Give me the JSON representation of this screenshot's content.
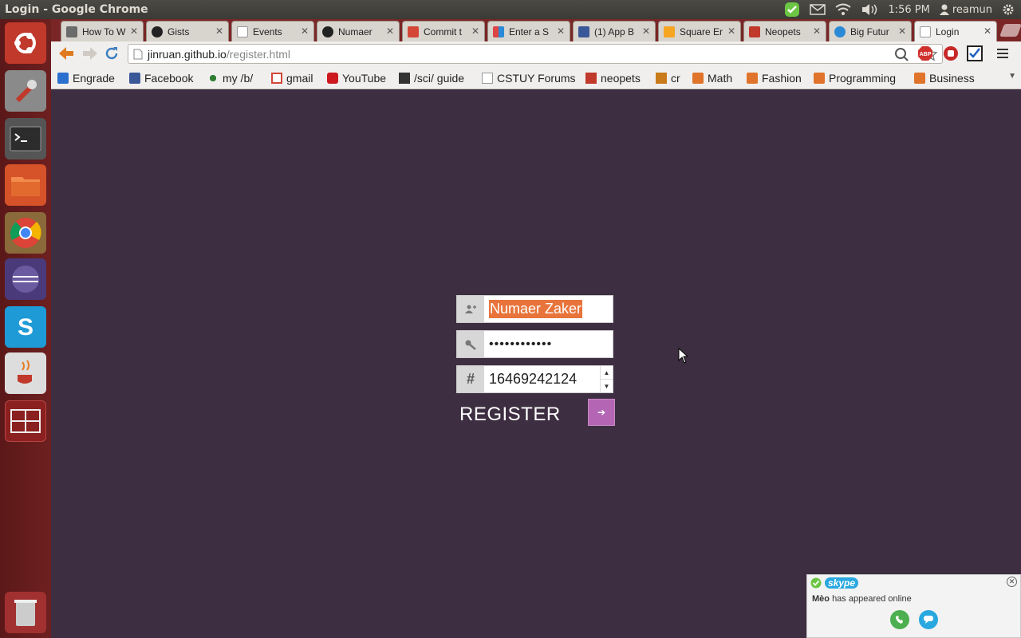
{
  "window": {
    "title": "Login - Google Chrome"
  },
  "panel": {
    "time": "1:56 PM",
    "user": "reamun"
  },
  "tabs": [
    {
      "label": "How To W",
      "icon_color": "#6b6b6b"
    },
    {
      "label": "Gists",
      "icon_color": "#222222"
    },
    {
      "label": "Events",
      "icon_color": "#ffffff"
    },
    {
      "label": "Numaer",
      "icon_color": "#222222"
    },
    {
      "label": "Commit t",
      "icon_color": "#d44638"
    },
    {
      "label": "Enter a S",
      "icon_color": "#e8a33c"
    },
    {
      "label": "(1) App B",
      "icon_color": "#3b5998"
    },
    {
      "label": "Square Er",
      "icon_color": "#f6a623"
    },
    {
      "label": "Neopets",
      "icon_color": "#c0392b"
    },
    {
      "label": "Big Futur",
      "icon_color": "#2b8ad6"
    },
    {
      "label": "Login",
      "icon_color": "#ffffff"
    }
  ],
  "address": {
    "host": "jinruan.github.io",
    "path": "/register.html"
  },
  "bookmarks": [
    {
      "label": "Engrade",
      "icon_color": "#2b6fcf"
    },
    {
      "label": "Facebook",
      "icon_color": "#3b5998"
    },
    {
      "label": "my /b/",
      "icon_color": "#2e7d32"
    },
    {
      "label": "gmail",
      "icon_color": "#d44638"
    },
    {
      "label": "YouTube",
      "icon_color": "#cc181e"
    },
    {
      "label": "/sci/ guide",
      "icon_color": "#333333"
    },
    {
      "label": "CSTUY Forums",
      "icon_color": "#ffffff"
    },
    {
      "label": "neopets",
      "icon_color": "#c0392b"
    },
    {
      "label": "cr",
      "icon_color": "#c97a1a"
    },
    {
      "label": "Math",
      "icon_color": "#e0742a"
    },
    {
      "label": "Fashion",
      "icon_color": "#e0742a"
    },
    {
      "label": "Programming",
      "icon_color": "#e0742a"
    },
    {
      "label": "Business",
      "icon_color": "#e0742a"
    }
  ],
  "form": {
    "name_value": "Numaer Zaker",
    "password_value": "••••••••••••",
    "id_value": "16469242124",
    "id_icon": "#",
    "register_label": "REGISTER",
    "submit_glyph": "➔"
  },
  "skype": {
    "brand": "skype",
    "contact": "Mèo",
    "message": "has appeared online"
  },
  "colors": {
    "page_bg": "#3e2e42",
    "accent": "#b466b4",
    "selection": "#e8743b",
    "launcher": "#6e2020"
  }
}
